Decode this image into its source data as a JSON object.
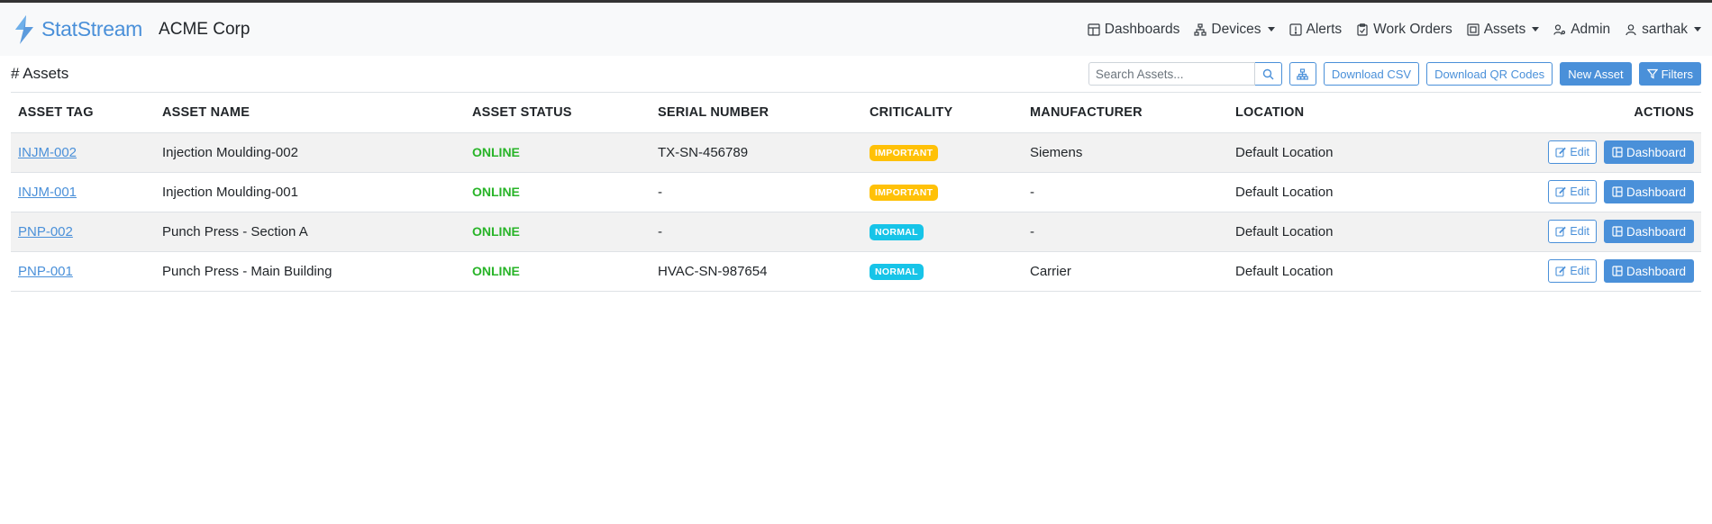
{
  "brand": {
    "name": "StatStream",
    "org": "ACME Corp",
    "color": "#4a90d9"
  },
  "nav": {
    "dashboards": "Dashboards",
    "devices": "Devices",
    "alerts": "Alerts",
    "work_orders": "Work Orders",
    "assets": "Assets",
    "admin": "Admin",
    "user": "sarthak"
  },
  "toolbar": {
    "title": "# Assets",
    "search_placeholder": "Search Assets...",
    "download_csv": "Download CSV",
    "download_qr": "Download QR Codes",
    "new_asset": "New Asset",
    "filters": "Filters"
  },
  "table": {
    "headers": {
      "asset_tag": "ASSET TAG",
      "asset_name": "ASSET NAME",
      "asset_status": "ASSET STATUS",
      "serial_number": "SERIAL NUMBER",
      "criticality": "CRITICALITY",
      "manufacturer": "MANUFACTURER",
      "location": "LOCATION",
      "actions": "ACTIONS"
    },
    "rows": [
      {
        "tag": "INJM-002",
        "name": "Injection Moulding-002",
        "status": "ONLINE",
        "serial": "TX-SN-456789",
        "criticality": "IMPORTANT",
        "manufacturer": "Siemens",
        "location": "Default Location",
        "edit": "Edit",
        "dashboard": "Dashboard"
      },
      {
        "tag": "INJM-001",
        "name": "Injection Moulding-001",
        "status": "ONLINE",
        "serial": "-",
        "criticality": "IMPORTANT",
        "manufacturer": "-",
        "location": "Default Location",
        "edit": "Edit",
        "dashboard": "Dashboard"
      },
      {
        "tag": "PNP-002",
        "name": "Punch Press - Section A",
        "status": "ONLINE",
        "serial": "-",
        "criticality": "NORMAL",
        "manufacturer": "-",
        "location": "Default Location",
        "edit": "Edit",
        "dashboard": "Dashboard"
      },
      {
        "tag": "PNP-001",
        "name": "Punch Press - Main Building",
        "status": "ONLINE",
        "serial": "HVAC-SN-987654",
        "criticality": "NORMAL",
        "manufacturer": "Carrier",
        "location": "Default Location",
        "edit": "Edit",
        "dashboard": "Dashboard"
      }
    ]
  },
  "colors": {
    "accent": "#4a90d9",
    "online": "#28b428",
    "important": "#ffc107",
    "normal": "#17c4e8"
  }
}
